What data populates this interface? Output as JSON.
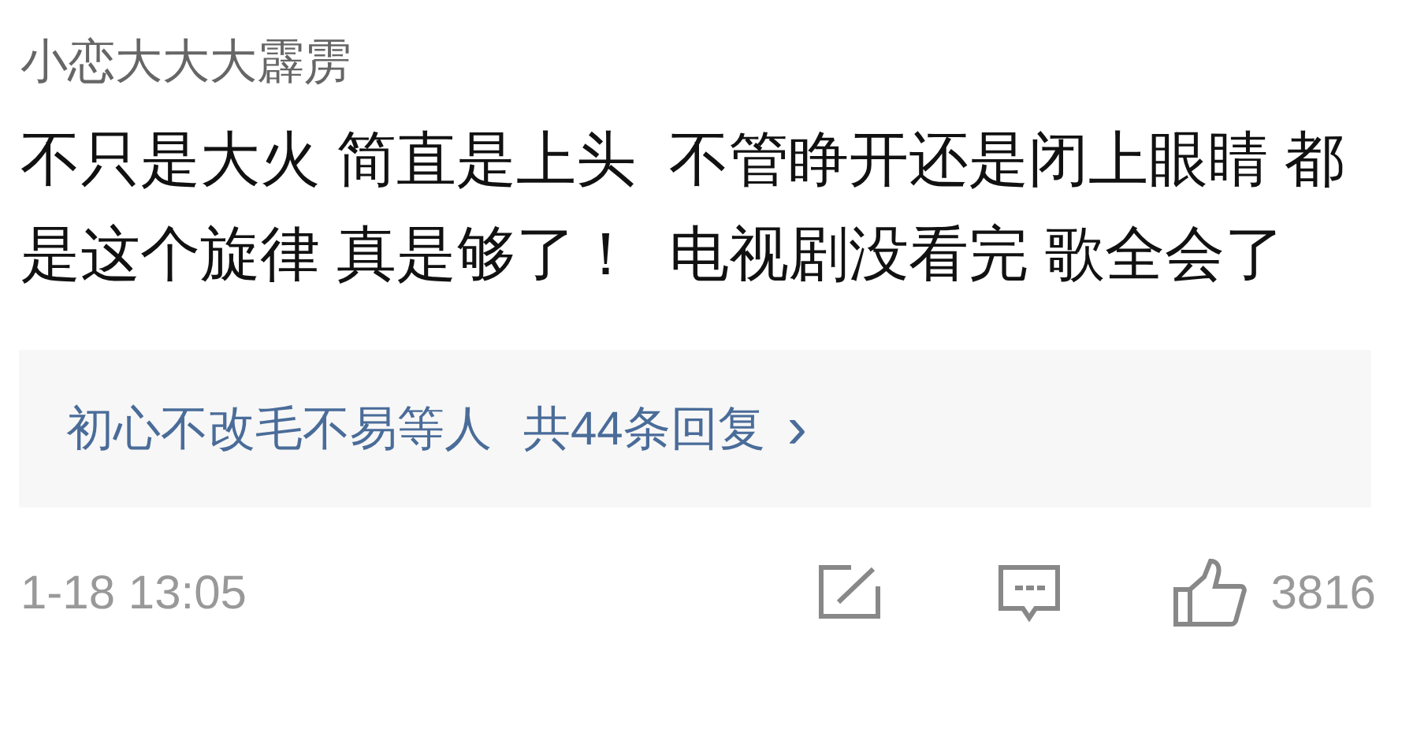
{
  "comment": {
    "author": "小恋大大大霹雳",
    "text": "不只是大火 简直是上头  不管睁开还是闭上眼睛 都是这个旋律 真是够了！  电视剧没看完 歌全会了"
  },
  "replies": {
    "users": "初心不改毛不易等人",
    "count": "共44条回复",
    "arrow": "›"
  },
  "footer": {
    "time": "1-18 13:05",
    "likes": "3816"
  }
}
